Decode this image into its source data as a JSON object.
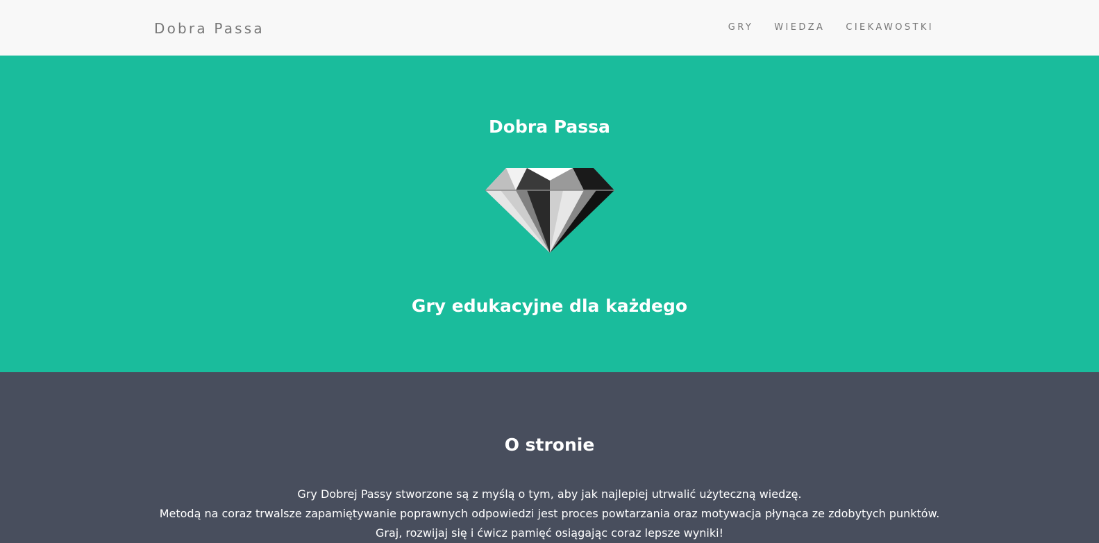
{
  "navbar": {
    "brand": "Dobra Passa",
    "links": [
      "GRY",
      "WIEDZA",
      "CIEKAWOSTKI"
    ]
  },
  "hero": {
    "title": "Dobra Passa",
    "image_icon": "diamond-icon",
    "subtitle": "Gry edukacyjne dla każdego"
  },
  "about": {
    "title": "O stronie",
    "lines": [
      "Gry Dobrej Passy stworzone są z myślą o tym, aby jak najlepiej utrwalić użyteczną wiedzę.",
      "Metodą na coraz trwalsze zapamiętywanie poprawnych odpowiedzi jest proces powtarzania oraz motywacja płynąca ze zdobytych punktów.",
      "Graj, rozwijaj się i ćwicz pamięć osiągając coraz lepsze wyniki!"
    ]
  },
  "colors": {
    "navbar_bg": "#f8f8f8",
    "hero_bg": "#1abc9c",
    "about_bg": "#484e5d",
    "nav_text": "#777777"
  }
}
